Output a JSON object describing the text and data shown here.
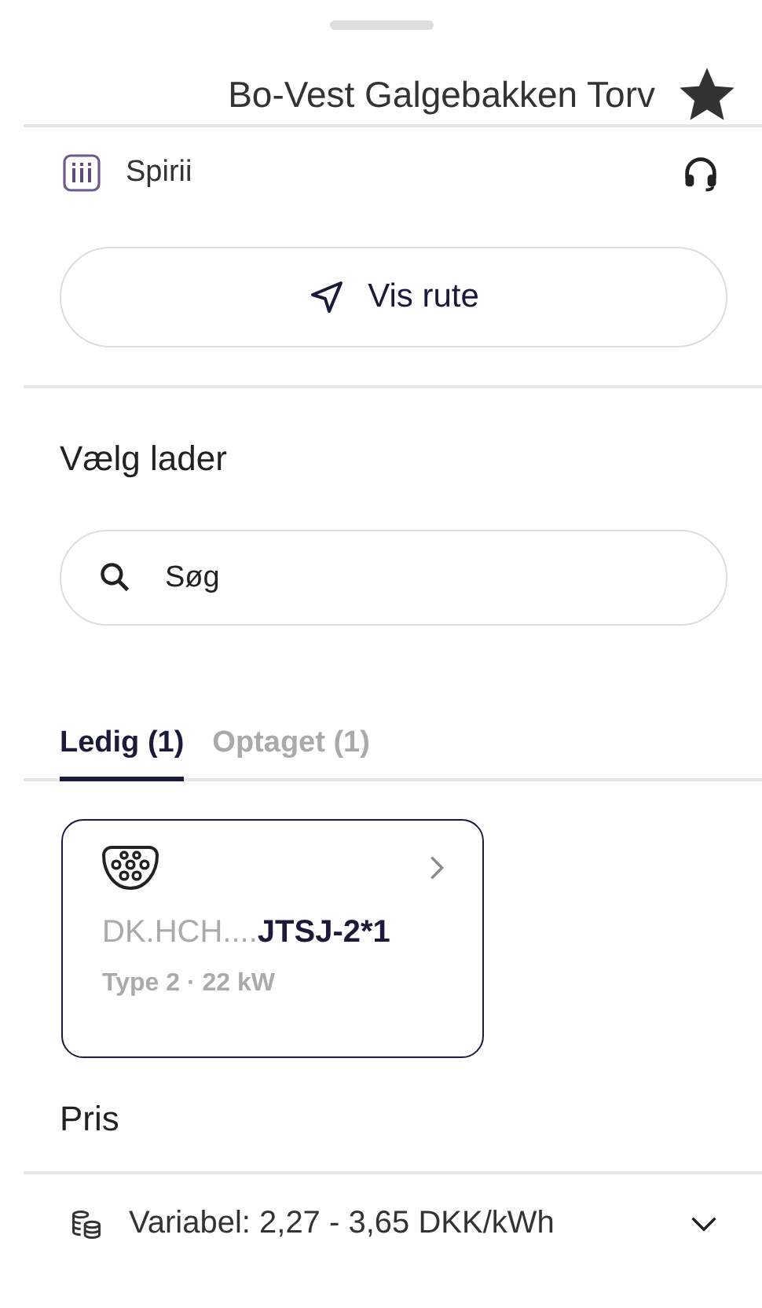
{
  "title": "Bo-Vest Galgebakken Torv",
  "favorite": true,
  "operator": {
    "name": "Spirii"
  },
  "route_button": {
    "label": "Vis rute"
  },
  "section_title": "Vælg lader",
  "search": {
    "placeholder": "Søg"
  },
  "tabs": [
    {
      "label": "Ledig (1)",
      "selected": true
    },
    {
      "label": "Optaget (1)",
      "selected": false
    }
  ],
  "chargers": [
    {
      "id_prefix": "DK.HCH....",
      "id_suffix": "JTSJ-2*1",
      "details": "Type 2 · 22 kW"
    }
  ],
  "price_title": "Pris",
  "price": {
    "label": "Variabel: 2,27 - 3,65 DKK/kWh",
    "expanded": false
  }
}
